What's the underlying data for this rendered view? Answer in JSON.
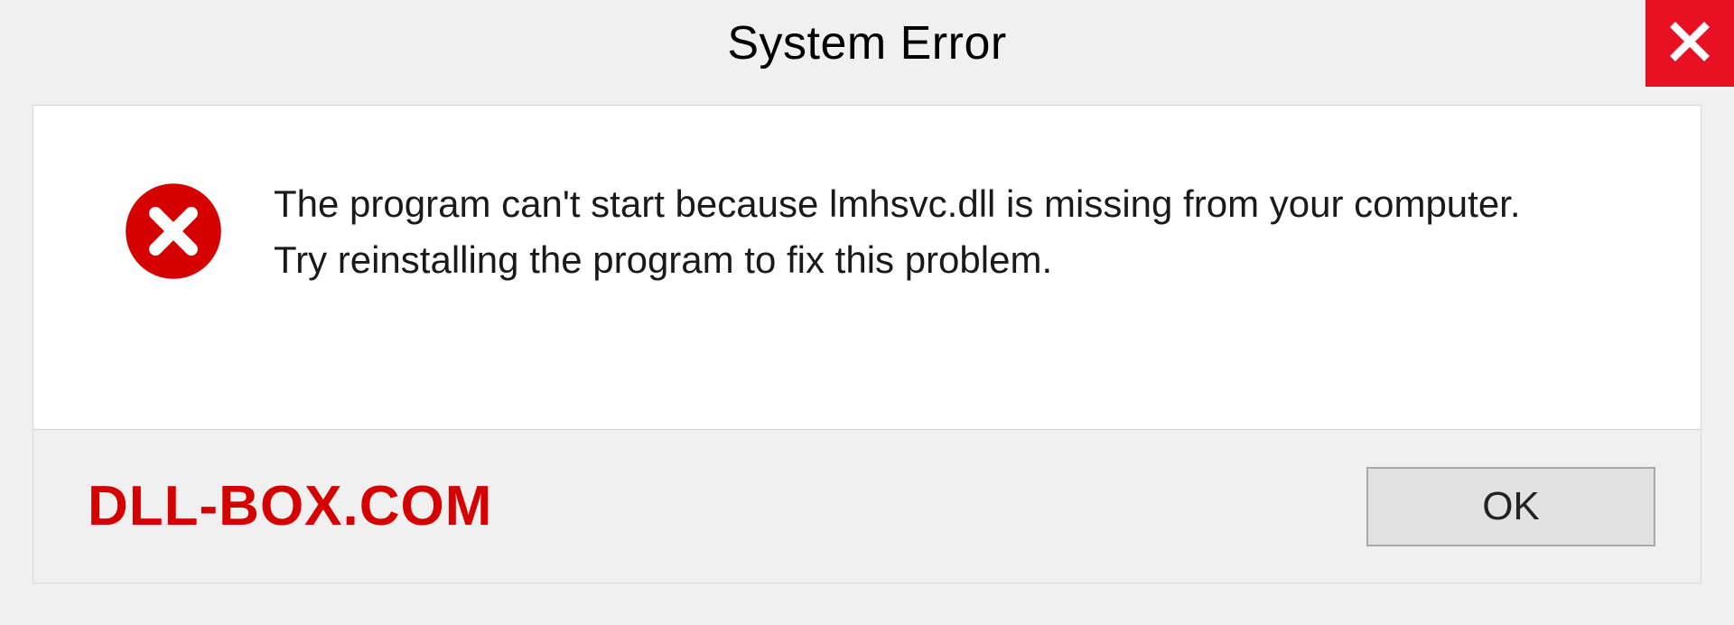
{
  "titlebar": {
    "title": "System Error"
  },
  "message": {
    "line1": "The program can't start because lmhsvc.dll is missing from your computer.",
    "line2": "Try reinstalling the program to fix this problem."
  },
  "footer": {
    "watermark": "DLL-BOX.COM",
    "ok_label": "OK"
  },
  "icons": {
    "close": "close-icon",
    "error": "error-circle-x-icon"
  },
  "colors": {
    "close_bg": "#e81123",
    "error_red": "#d50000",
    "panel_bg": "#ffffff",
    "page_bg": "#f0f0f0"
  }
}
